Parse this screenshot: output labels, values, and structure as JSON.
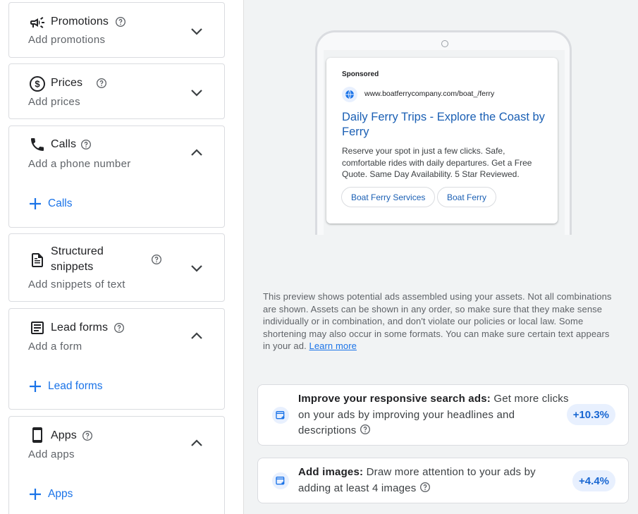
{
  "sections": [
    {
      "id": "promotions",
      "title": "Promotions",
      "subtitle": "Add promotions",
      "icon": "megaphone-icon",
      "expanded": false
    },
    {
      "id": "prices",
      "title": "Prices",
      "subtitle": "Add prices",
      "icon": "dollar-icon",
      "expanded": false
    },
    {
      "id": "calls",
      "title": "Calls",
      "subtitle": "Add a phone number",
      "icon": "phone-icon",
      "expanded": true,
      "add_label": "Calls"
    },
    {
      "id": "structured-snippets",
      "title_line1": "Structured",
      "title_line2": "snippets",
      "subtitle": "Add snippets of text",
      "icon": "document-icon",
      "expanded": false
    },
    {
      "id": "lead-forms",
      "title": "Lead forms",
      "subtitle": "Add a form",
      "icon": "form-icon",
      "expanded": true,
      "add_label": "Lead forms"
    },
    {
      "id": "apps",
      "title": "Apps",
      "subtitle": "Add apps",
      "icon": "smartphone-icon",
      "expanded": true,
      "add_label": "Apps"
    }
  ],
  "ad_preview": {
    "sponsored": "Sponsored",
    "url": "www.boatferrycompany.com/boat_/ferry",
    "headline": "Daily Ferry Trips - Explore the Coast by Ferry",
    "description": "Reserve your spot in just a few clicks. Safe, comfortable rides with daily departures. Get a Free Quote. Same Day Availability. 5 Star Reviewed.",
    "sitelinks": [
      "Boat Ferry Services",
      "Boat Ferry"
    ]
  },
  "preview_note": {
    "text": "This preview shows potential ads assembled using your assets. Not all combinations are shown. Assets can be shown in any order, so make sure that they make sense individually or in combination, and don't violate our policies or local law. Some shortening may also occur in some formats. You can make sure certain text appears in your ad. ",
    "link": "Learn more"
  },
  "recommendations": [
    {
      "title": "Improve your responsive search ads:",
      "body": " Get more clicks on your ads by improving your headlines and descriptions",
      "uplift": "+10.3%"
    },
    {
      "title": "Add images:",
      "body": " Draw more attention to your ads by adding at least 4 images",
      "uplift": "+4.4%"
    }
  ],
  "colors": {
    "accent": "#1a73e8",
    "link": "#1a5fb4",
    "panel_bg": "#f1f3f4",
    "pill_bg": "#e8f0fe"
  }
}
